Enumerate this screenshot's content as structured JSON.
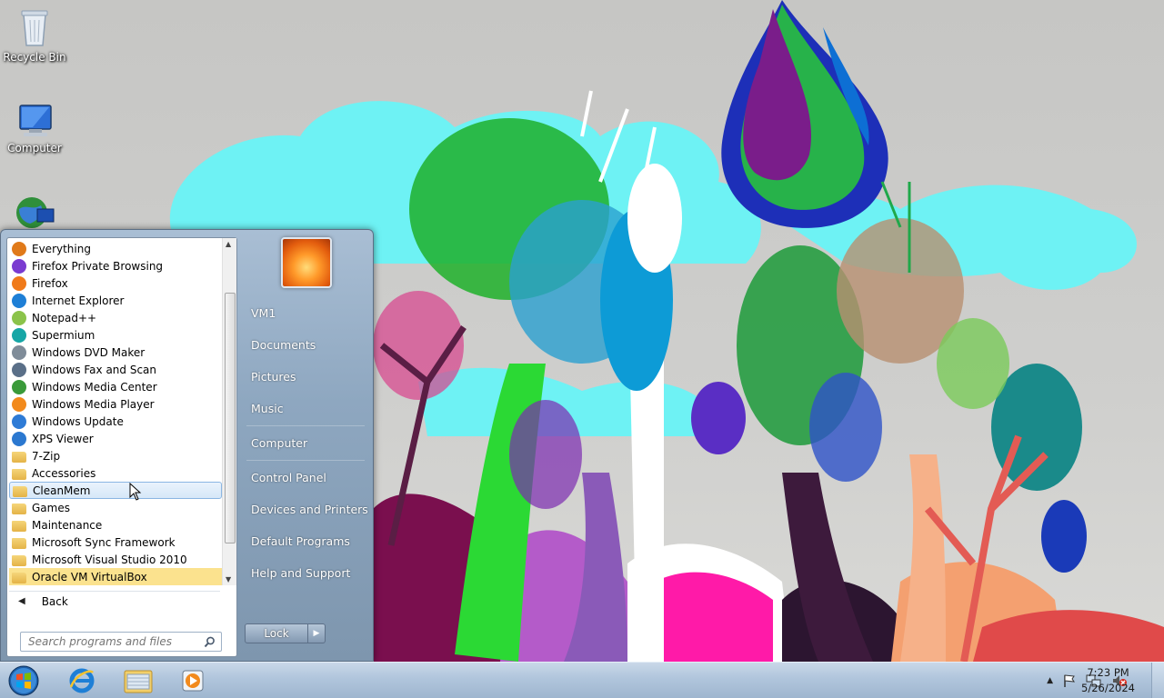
{
  "desktop": {
    "icons": [
      {
        "label": "Recycle Bin",
        "icon": "recycle-bin-icon"
      },
      {
        "label": "Computer",
        "icon": "computer-icon"
      },
      {
        "label": "",
        "icon": "network-globe-icon"
      }
    ]
  },
  "start_menu": {
    "programs": [
      {
        "label": "Everything",
        "icon": "everything-search-icon"
      },
      {
        "label": "Firefox Private Browsing",
        "icon": "firefox-private-icon"
      },
      {
        "label": "Firefox",
        "icon": "firefox-icon"
      },
      {
        "label": "Internet Explorer",
        "icon": "internet-explorer-icon"
      },
      {
        "label": "Notepad++",
        "icon": "notepad-plus-plus-icon"
      },
      {
        "label": "Supermium",
        "icon": "supermium-icon"
      },
      {
        "label": "Windows DVD Maker",
        "icon": "dvd-maker-icon"
      },
      {
        "label": "Windows Fax and Scan",
        "icon": "fax-scan-icon"
      },
      {
        "label": "Windows Media Center",
        "icon": "media-center-icon"
      },
      {
        "label": "Windows Media Player",
        "icon": "media-player-icon"
      },
      {
        "label": "Windows Update",
        "icon": "windows-update-icon"
      },
      {
        "label": "XPS Viewer",
        "icon": "xps-viewer-icon"
      },
      {
        "label": "7-Zip",
        "icon": "folder-icon"
      },
      {
        "label": "Accessories",
        "icon": "folder-icon"
      },
      {
        "label": "CleanMem",
        "icon": "folder-icon"
      },
      {
        "label": "Games",
        "icon": "folder-icon"
      },
      {
        "label": "Maintenance",
        "icon": "folder-icon"
      },
      {
        "label": "Microsoft Sync Framework",
        "icon": "folder-icon"
      },
      {
        "label": "Microsoft Visual Studio 2010",
        "icon": "folder-icon"
      },
      {
        "label": "Oracle VM VirtualBox",
        "icon": "folder-icon"
      }
    ],
    "hovered_item": "CleanMem",
    "selected_item": "Oracle VM VirtualBox",
    "back_label": "Back",
    "search_placeholder": "Search programs and files",
    "right_items": {
      "user": "VM1",
      "documents": "Documents",
      "pictures": "Pictures",
      "music": "Music",
      "computer": "Computer",
      "control_panel": "Control Panel",
      "devices": "Devices and Printers",
      "default_programs": "Default Programs",
      "help": "Help and Support"
    },
    "lock_label": "Lock"
  },
  "taskbar": {
    "pinned": [
      "internet-explorer-icon",
      "windows-explorer-icon",
      "media-player-icon"
    ],
    "tray_icons": [
      "show-hidden-icons-chevron",
      "action-center-flag-icon",
      "network-icon",
      "volume-muted-icon"
    ],
    "time": "7:23 PM",
    "date": "5/26/2024"
  },
  "colors": {
    "taskbar": "#b0c5dc",
    "start_menu_right": "#8ea7c0",
    "hover_highlight": "#d6e7f8",
    "selected_highlight": "#fbe28e"
  }
}
